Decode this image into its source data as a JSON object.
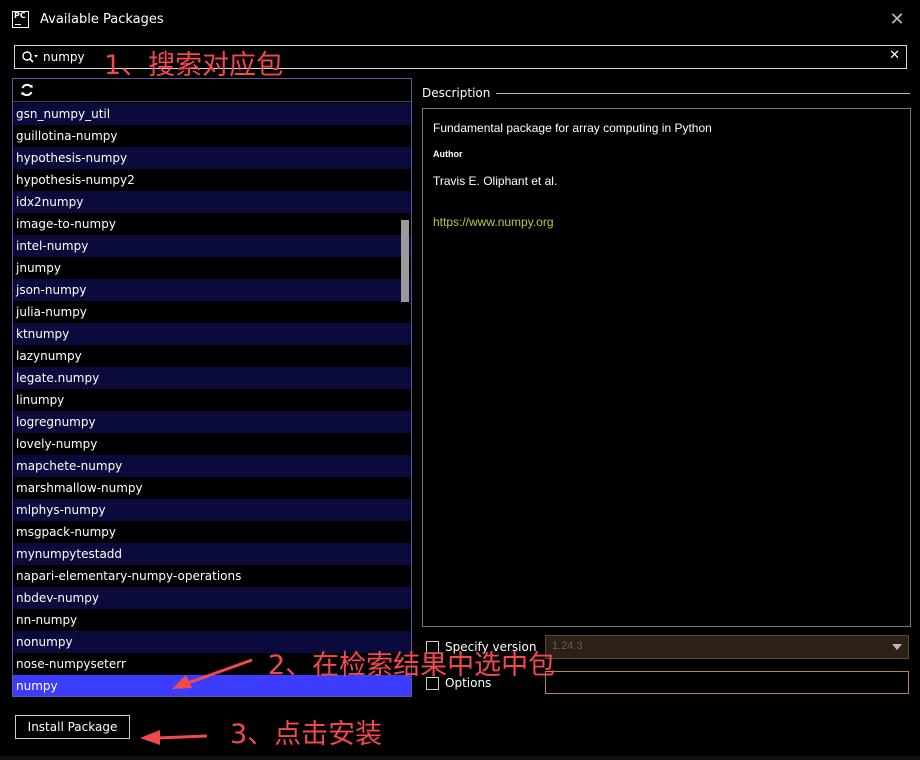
{
  "window": {
    "title": "Available Packages",
    "app_icon_text": "PC",
    "close_symbol": "✕"
  },
  "search": {
    "value": "numpy",
    "clear_symbol": "✕"
  },
  "packages": [
    "gsn_numpy_util",
    "guillotina-numpy",
    "hypothesis-numpy",
    "hypothesis-numpy2",
    "idx2numpy",
    "image-to-numpy",
    "intel-numpy",
    "jnumpy",
    "json-numpy",
    "julia-numpy",
    "ktnumpy",
    "lazynumpy",
    "legate.numpy",
    "linumpy",
    "logregnumpy",
    "lovely-numpy",
    "mapchete-numpy",
    "marshmallow-numpy",
    "mlphys-numpy",
    "msgpack-numpy",
    "mynumpytestadd",
    "napari-elementary-numpy-operations",
    "nbdev-numpy",
    "nn-numpy",
    "nonumpy",
    "nose-numpyseterr",
    "numpy"
  ],
  "selected_package": "numpy",
  "description": {
    "header": "Description",
    "summary": "Fundamental package for array computing in Python",
    "author_label": "Author",
    "author": "Travis E. Oliphant et al.",
    "homepage": "https://www.numpy.org"
  },
  "version": {
    "label": "Specify version",
    "value": "1.24.3"
  },
  "options": {
    "label": "Options",
    "value": ""
  },
  "install_button": "Install Package",
  "annotations": {
    "step1": "1、搜索对应包",
    "step2": "2、在检索结果中选中包",
    "step3": "3、点击安装"
  },
  "colors": {
    "selected_row": "#3c3cff",
    "alt_row": "#0a0a3c",
    "annotation": "#f24a4a",
    "link": "#b5cc3c"
  }
}
